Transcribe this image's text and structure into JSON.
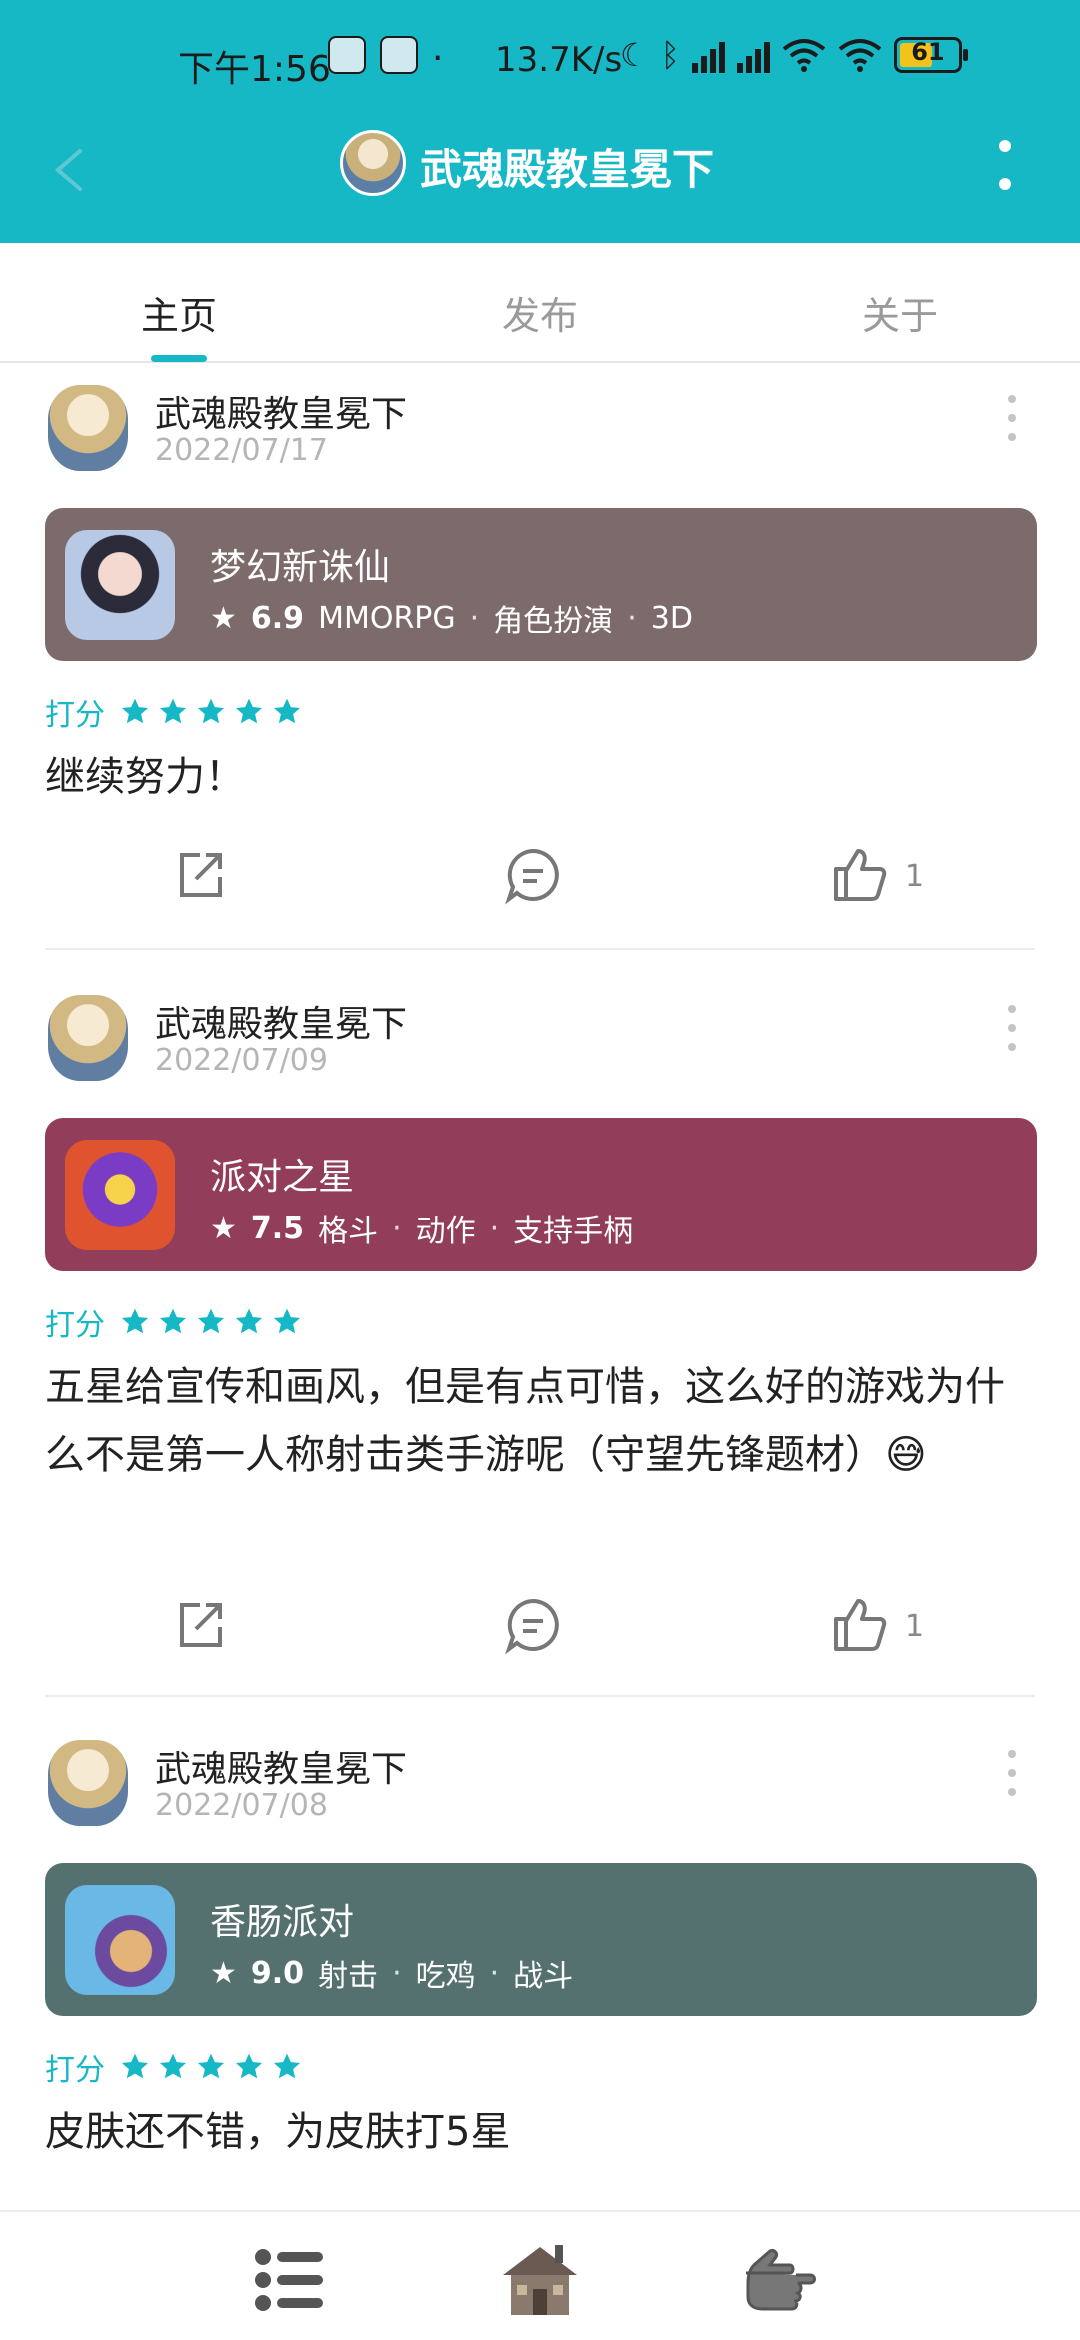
{
  "status_bar": {
    "time": "下午1:56",
    "separator": "·",
    "speed": "13.7K/s",
    "icons": [
      "moon-icon",
      "bluetooth-icon",
      "hd-signal-icon",
      "hd-signal-icon",
      "wifi-icon",
      "wifi6-icon"
    ],
    "battery_level": "61"
  },
  "header": {
    "title": "武魂殿教皇冕下",
    "bg_color": "#17b8c6"
  },
  "tabs": [
    {
      "label": "主页",
      "active": true
    },
    {
      "label": "发布",
      "active": false
    },
    {
      "label": "关于",
      "active": false
    }
  ],
  "posts": [
    {
      "user": "武魂殿教皇冕下",
      "date": "2022/07/17",
      "game": {
        "name": "梦幻新诛仙",
        "score": "6.9",
        "tags": [
          "MMORPG",
          "角色扮演",
          "3D"
        ],
        "card_color": "#7d6b6b"
      },
      "rating_label": "打分",
      "stars": 5,
      "review": "继续努力！",
      "likes": "1"
    },
    {
      "user": "武魂殿教皇冕下",
      "date": "2022/07/09",
      "game": {
        "name": "派对之星",
        "score": "7.5",
        "tags": [
          "格斗",
          "动作",
          "支持手柄"
        ],
        "card_color": "#923d59"
      },
      "rating_label": "打分",
      "stars": 5,
      "review": "五星给宣传和画风，但是有点可惜，这么好的游戏为什么不是第一人称射击类手游呢（守望先锋题材）😅",
      "likes": "1"
    },
    {
      "user": "武魂殿教皇冕下",
      "date": "2022/07/08",
      "game": {
        "name": "香肠派对",
        "score": "9.0",
        "tags": [
          "射击",
          "吃鸡",
          "战斗"
        ],
        "card_color": "#55716f"
      },
      "rating_label": "打分",
      "stars": 5,
      "review": "皮肤还不错，为皮肤打5星"
    }
  ],
  "bottom_nav": [
    "list-icon",
    "cabin-icon",
    "pointing-hand-icon"
  ]
}
